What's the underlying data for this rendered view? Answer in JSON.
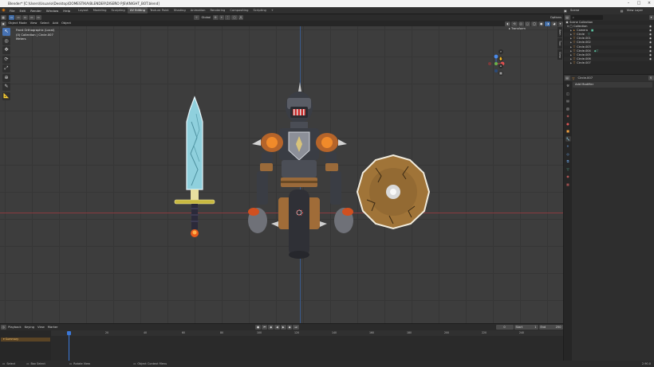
{
  "window": {
    "title": "Blender* [C:\\Users\\Usuario\\Desktop\\DOMESTIKA\\BLENDER\\DISEÑO PJS\\KNIGHT_BOT.blend]"
  },
  "topbar": {
    "menus": [
      "File",
      "Edit",
      "Render",
      "Window",
      "Help"
    ],
    "workspaces": [
      "Layout",
      "Modeling",
      "Sculpting",
      "UV Editing",
      "Texture Paint",
      "Shading",
      "Animation",
      "Rendering",
      "Compositing",
      "Scripting"
    ],
    "active_workspace": "UV Editing",
    "scene_label": "Scene",
    "view_layer_label": "View Layer"
  },
  "viewport_header": {
    "mode": "Object Mode",
    "menus": [
      "View",
      "Select",
      "Add",
      "Object"
    ],
    "orientation": "Global",
    "options_label": "Options"
  },
  "viewport": {
    "info_line1": "Front Orthographic (Local)",
    "info_line2": "(0) Collection | Circle.007",
    "info_line3": "Meters",
    "transform_label": "Transform",
    "npanel_tabs": [
      "Item",
      "Tool",
      "View"
    ],
    "colors": {
      "background": "#3d3d3d",
      "x_axis": "#8a3a3f",
      "y_axis": "#3a5a8c",
      "active_tool": "#4772b3"
    }
  },
  "timeline": {
    "menus": [
      "Playback",
      "Keying",
      "View",
      "Marker"
    ],
    "current_frame": "0",
    "start_label": "Start",
    "start_value": "1",
    "end_label": "End",
    "end_value": "250",
    "ticks": [
      "0",
      "20",
      "40",
      "60",
      "80",
      "100",
      "120",
      "140",
      "160",
      "180",
      "200",
      "220",
      "240"
    ],
    "summary_label": "Summary"
  },
  "statusbar": {
    "select": "Select",
    "box_select": "Box Select",
    "rotate_view": "Rotate View",
    "context_menu": "Object Context Menu",
    "version": "2.90.0"
  },
  "outliner": {
    "title": "Scene Collection",
    "items": [
      {
        "label": "Collection",
        "icon": "collection-icon",
        "indent": 1
      },
      {
        "label": "Camera",
        "icon": "camera-icon",
        "indent": 2
      },
      {
        "label": "Circle",
        "icon": "mesh-icon",
        "indent": 2
      },
      {
        "label": "Circle.001",
        "icon": "mesh-icon",
        "indent": 2
      },
      {
        "label": "Circle.002",
        "icon": "mesh-icon",
        "indent": 2
      },
      {
        "label": "Circle.003",
        "icon": "mesh-icon",
        "indent": 2
      },
      {
        "label": "Circle.004",
        "icon": "mesh-icon",
        "indent": 2
      },
      {
        "label": "Circle.005",
        "icon": "mesh-icon",
        "indent": 2
      },
      {
        "label": "Circle.006",
        "icon": "mesh-icon",
        "indent": 2
      },
      {
        "label": "Circle.007",
        "icon": "mesh-icon",
        "indent": 2
      }
    ]
  },
  "properties": {
    "object_name": "Circle.007",
    "add_modifier": "Add Modifier"
  }
}
